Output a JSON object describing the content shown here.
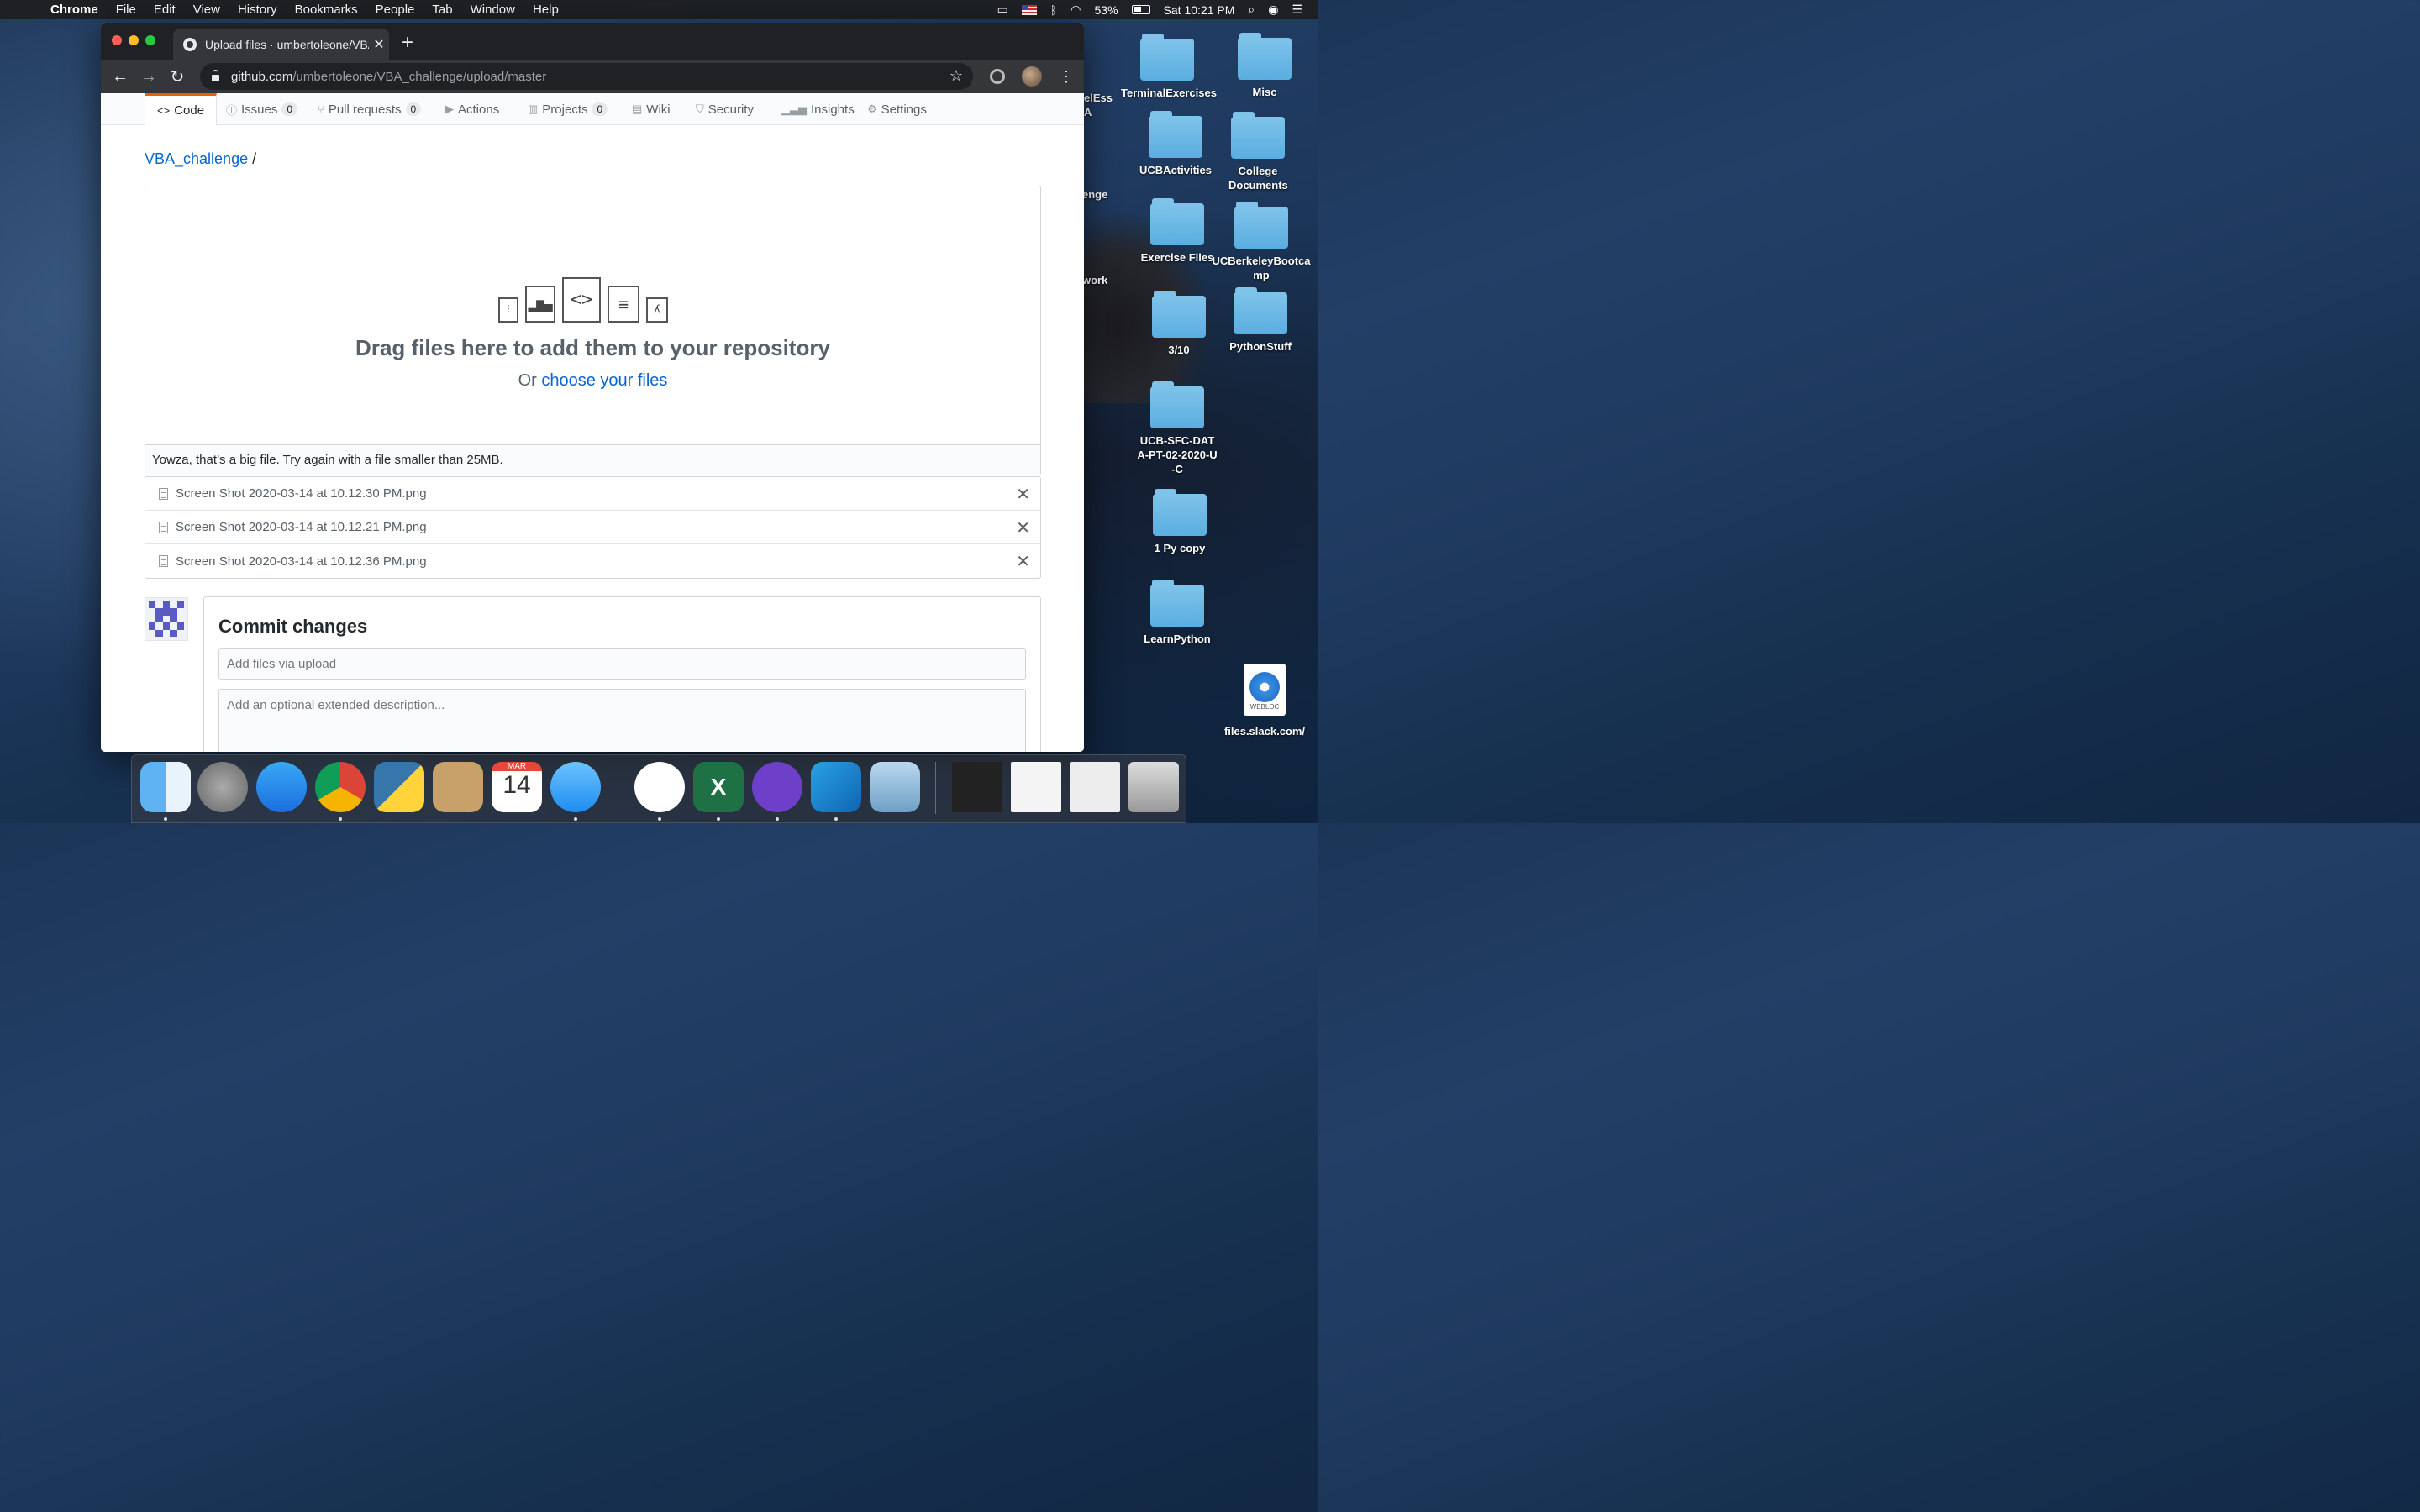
{
  "menubar": {
    "app": "Chrome",
    "items": [
      "File",
      "Edit",
      "View",
      "History",
      "Bookmarks",
      "People",
      "Tab",
      "Window",
      "Help"
    ],
    "battery": "53%",
    "clock": "Sat 10:21 PM"
  },
  "browser": {
    "tab_title": "Upload files · umbertoleone/VBA",
    "url_host": "github.com",
    "url_path": "/umbertoleone/VBA_challenge/upload/master"
  },
  "repo_nav": {
    "items": [
      {
        "label": "Code",
        "icon": "code-icon",
        "count": null
      },
      {
        "label": "Issues",
        "icon": "issue-icon",
        "count": "0"
      },
      {
        "label": "Pull requests",
        "icon": "pull-request-icon",
        "count": "0"
      },
      {
        "label": "Actions",
        "icon": "play-icon",
        "count": null
      },
      {
        "label": "Projects",
        "icon": "project-icon",
        "count": "0"
      },
      {
        "label": "Wiki",
        "icon": "book-icon",
        "count": null
      },
      {
        "label": "Security",
        "icon": "shield-icon",
        "count": null
      },
      {
        "label": "Insights",
        "icon": "graph-icon",
        "count": null
      },
      {
        "label": "Settings",
        "icon": "gear-icon",
        "count": null
      }
    ]
  },
  "breadcrumb": {
    "repo": "VBA_challenge",
    "sep": "/"
  },
  "dropzone": {
    "title": "Drag files here to add them to your repository",
    "or": "Or",
    "choose": "choose your files",
    "error": "Yowza, that’s a big file. Try again with a file smaller than 25MB."
  },
  "files": [
    "Screen Shot 2020-03-14 at 10.12.30 PM.png",
    "Screen Shot 2020-03-14 at 10.12.21 PM.png",
    "Screen Shot 2020-03-14 at 10.12.36 PM.png"
  ],
  "commit": {
    "heading": "Commit changes",
    "summary_placeholder": "Add files via upload",
    "description_placeholder": "Add an optional extended description..."
  },
  "desktop": {
    "icons": [
      "elEss",
      "A",
      "TerminalExercises",
      "Misc",
      "UCBActivities",
      "College Documents",
      "enge",
      "Exercise Files",
      "UCBerkeleyBootcamp",
      "work",
      "3/10",
      "PythonStuff",
      "UCB-SFC-DATA-PT-02-2020-U-C",
      "1 Py copy",
      "LearnPython",
      "files.slack.com/"
    ],
    "webloc_label": "WEBLOC"
  },
  "dock": {
    "calendar_month": "MAR",
    "calendar_day": "14",
    "excel_letter": "X"
  }
}
